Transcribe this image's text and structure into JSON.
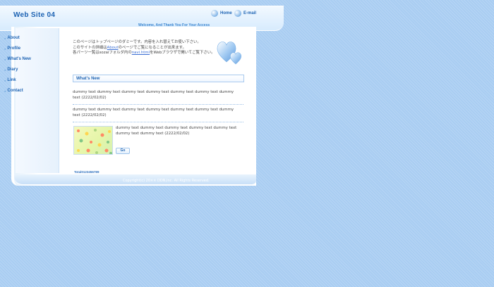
{
  "header": {
    "site_title": "Web Site 04",
    "nav": [
      {
        "label": "Home",
        "icon": "orb-icon"
      },
      {
        "label": "E-mail",
        "icon": "orb-icon"
      }
    ],
    "welcome": "Welcome, And Thank You For Your Access"
  },
  "sidebar": {
    "items": [
      {
        "label": "About"
      },
      {
        "label": "Profile"
      },
      {
        "label": "What's New"
      },
      {
        "label": "Diary"
      },
      {
        "label": "Link"
      },
      {
        "label": "Contact"
      }
    ]
  },
  "main": {
    "intro": {
      "line1": "このページはトップページのダミーです。内容を入れ替えてお使い下さい。",
      "line2_pre": "このサイトの詳細は",
      "line2_link": "About",
      "line2_post": "のページでご覧になることが出来ます。",
      "line3_pre": "各パーツ一覧はsozaiフォルダ内の",
      "line3_link": "navi.html",
      "line3_post": "をWebブラウザで開いてご覧下さい。"
    },
    "section_title": "What's New",
    "news": [
      {
        "text": "dummy text dummy text dummy text dummy text dummy text dummy text dummy text (2222/02/02)"
      },
      {
        "text": "dummy text dummy text dummy text dummy text dummy text dummy text dummy text (2222/02/02)"
      },
      {
        "text": "dummy text dummy text dummy text dummy text dummy text dummy text dummy text (2222/02/02)"
      }
    ],
    "go_label": "Go",
    "counter": "Total0123456789"
  },
  "footer": {
    "copyright": "Copyright(c) 20×× DDN,Inc. All Rights Reserved."
  },
  "colors": {
    "background": "#a9cdf2",
    "accent": "#1d63b3",
    "link": "#3b6fd4"
  }
}
